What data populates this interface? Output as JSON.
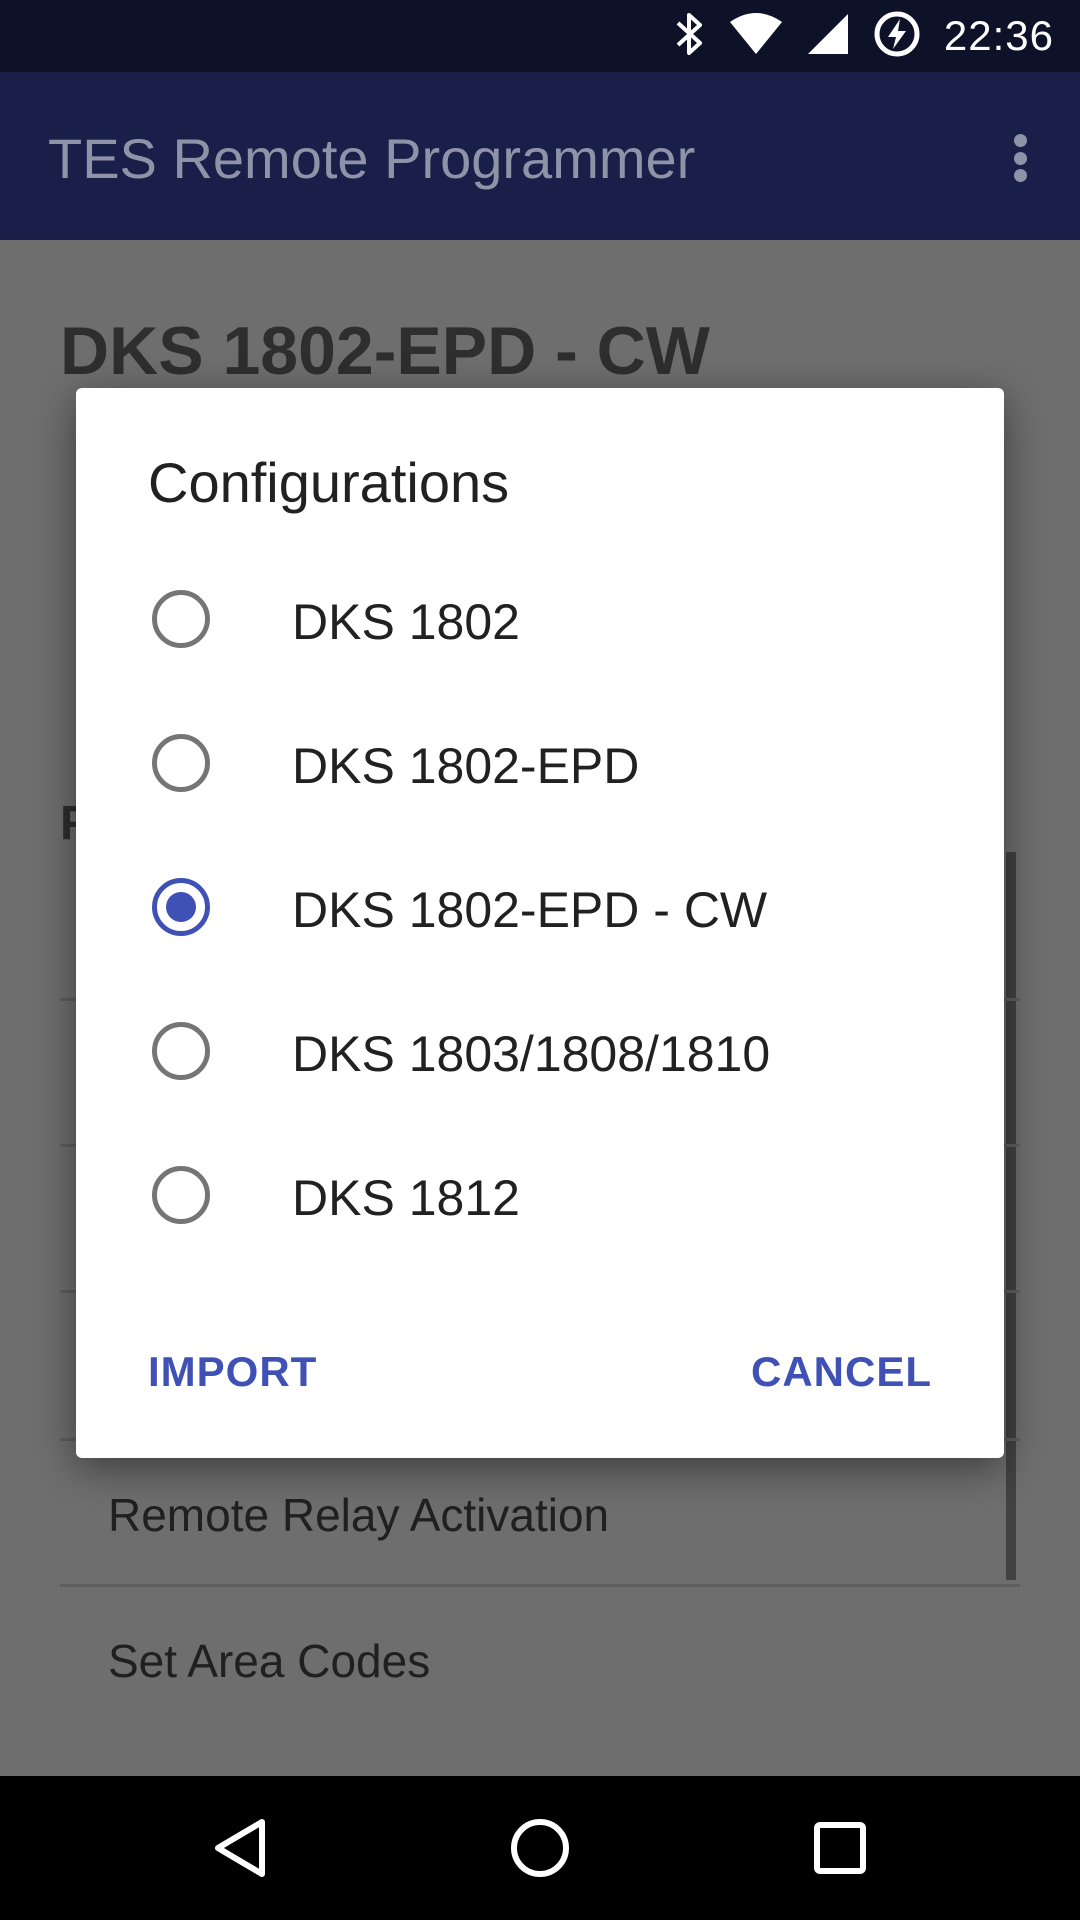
{
  "status_bar": {
    "time": "22:36",
    "icons": [
      "bluetooth-icon",
      "wifi-icon",
      "signal-icon",
      "battery-charging-icon"
    ]
  },
  "app_bar": {
    "title": "TES Remote Programmer",
    "overflow_icon": "more-vert-icon"
  },
  "background": {
    "device_title": "DKS 1802-EPD - CW",
    "section_partial": "F",
    "menu_items": [
      "Remote Relay Activation",
      "Set Area Codes"
    ]
  },
  "dialog": {
    "title": "Configurations",
    "options": [
      {
        "label": "DKS 1802",
        "selected": false
      },
      {
        "label": "DKS 1802-EPD",
        "selected": false
      },
      {
        "label": "DKS 1802-EPD - CW",
        "selected": true
      },
      {
        "label": "DKS 1803/1808/1810",
        "selected": false
      },
      {
        "label": "DKS 1812",
        "selected": false
      }
    ],
    "import_label": "IMPORT",
    "cancel_label": "CANCEL",
    "accent_color": "#3f51b5"
  },
  "nav_bar": {
    "icons": [
      "back-icon",
      "home-icon",
      "recents-icon"
    ]
  }
}
